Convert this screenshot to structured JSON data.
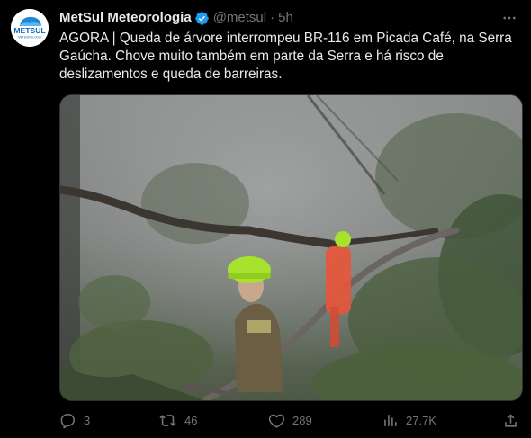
{
  "tweet": {
    "author": {
      "display_name": "MetSul Meteorologia",
      "handle": "@metsul",
      "separator": "·",
      "time": "5h",
      "verified": true,
      "avatar_text": "METSUL",
      "avatar_subtext": "METEOROLOGIA"
    },
    "text": "AGORA | Queda de árvore interrompeu BR-116 em Picada Café, na Serra\nGaúcha. Chove muito também em parte da Serra e há risco de\ndeslizamentos e queda de barreiras.",
    "media": {
      "type": "photo",
      "description_icon": "photo-fallen-tree-firefighters"
    },
    "actions": {
      "replies": "3",
      "reposts": "46",
      "likes": "289",
      "views": "27.7K"
    }
  },
  "colors": {
    "background": "#000000",
    "text_primary": "#e7e9ea",
    "text_secondary": "#71767b",
    "verified": "#1d9bf0",
    "border": "#2f3336",
    "helmet": "#a6e22e",
    "suit": "#e8553a"
  }
}
